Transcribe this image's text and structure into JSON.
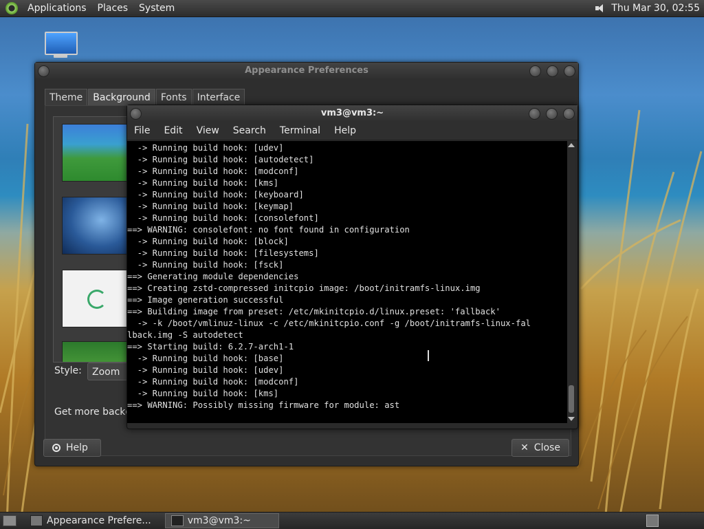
{
  "top_panel": {
    "menus": [
      "Applications",
      "Places",
      "System"
    ],
    "clock": "Thu Mar 30, 02:55"
  },
  "appearance_window": {
    "title": "Appearance Preferences",
    "tabs": [
      "Theme",
      "Background",
      "Fonts",
      "Interface"
    ],
    "active_tab": "Background",
    "style_label": "Style:",
    "style_value": "Zoom",
    "get_more_text": "Get more backgro",
    "help_label": "Help",
    "close_label": "Close"
  },
  "terminal_window": {
    "title": "vm3@vm3:~",
    "menus": [
      "File",
      "Edit",
      "View",
      "Search",
      "Terminal",
      "Help"
    ],
    "lines": [
      "  -> Running build hook: [udev]",
      "  -> Running build hook: [autodetect]",
      "  -> Running build hook: [modconf]",
      "  -> Running build hook: [kms]",
      "  -> Running build hook: [keyboard]",
      "  -> Running build hook: [keymap]",
      "  -> Running build hook: [consolefont]",
      "==> WARNING: consolefont: no font found in configuration",
      "  -> Running build hook: [block]",
      "  -> Running build hook: [filesystems]",
      "  -> Running build hook: [fsck]",
      "==> Generating module dependencies",
      "==> Creating zstd-compressed initcpio image: /boot/initramfs-linux.img",
      "==> Image generation successful",
      "==> Building image from preset: /etc/mkinitcpio.d/linux.preset: 'fallback'",
      "  -> -k /boot/vmlinuz-linux -c /etc/mkinitcpio.conf -g /boot/initramfs-linux-fal",
      "lback.img -S autodetect",
      "==> Starting build: 6.2.7-arch1-1",
      "  -> Running build hook: [base]",
      "  -> Running build hook: [udev]",
      "  -> Running build hook: [modconf]",
      "  -> Running build hook: [kms]",
      "==> WARNING: Possibly missing firmware for module: ast"
    ]
  },
  "taskbar": {
    "tasks": [
      "Appearance Prefere...",
      "vm3@vm3:~"
    ]
  }
}
